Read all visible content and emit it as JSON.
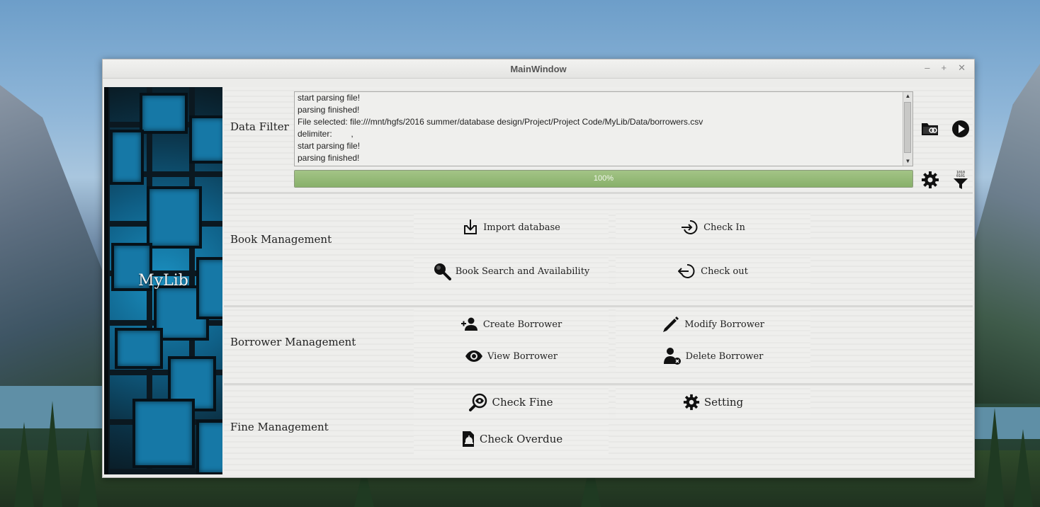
{
  "window": {
    "title": "MainWindow",
    "controls": {
      "minimize": "–",
      "maximize": "+",
      "close": "✕"
    }
  },
  "sidebar": {
    "brand": "MyLib"
  },
  "data_filter": {
    "label": "Data Filter",
    "log_lines": [
      "start parsing file!",
      "parsing finished!",
      "File selected: file:///mnt/hgfs/2016 summer/database design/Project/Project Code/MyLib/Data/borrowers.csv",
      "delimiter:        ,",
      "start parsing file!",
      "parsing finished!"
    ],
    "progress_value": 1.0,
    "progress_text": "100%",
    "icons": [
      "folder-link-icon",
      "play-icon",
      "gear-icon",
      "binary-filter-icon"
    ]
  },
  "book_management": {
    "label": "Book Management",
    "buttons": {
      "import": "Import database",
      "check_in": "Check In",
      "search": "Book Search and Availability",
      "check_out": "Check out"
    }
  },
  "borrower_management": {
    "label": "Borrower Management",
    "buttons": {
      "create": "Create Borrower",
      "modify": "Modify Borrower",
      "view": "View Borrower",
      "delete": "Delete Borrower"
    }
  },
  "fine_management": {
    "label": "Fine Management",
    "buttons": {
      "check_fine": "Check Fine",
      "setting": "Setting",
      "check_overdue": "Check Overdue"
    }
  },
  "colors": {
    "progress_fill": "#88b06a",
    "window_bg": "#ececea",
    "sidebar_accent": "#1678a6"
  }
}
